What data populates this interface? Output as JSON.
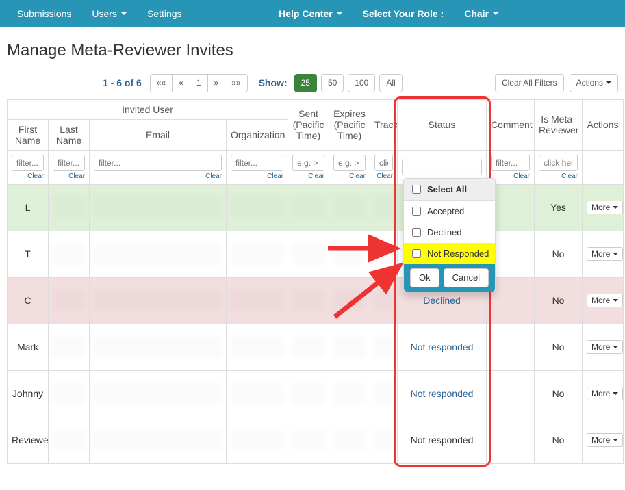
{
  "nav": {
    "submissions": "Submissions",
    "users": "Users",
    "settings": "Settings",
    "help": "Help Center",
    "role_label": "Select Your Role :",
    "role_value": "Chair"
  },
  "page_title": "Manage Meta-Reviewer Invites",
  "pager": {
    "info": "1 - 6 of 6",
    "first": "««",
    "prev": "«",
    "page": "1",
    "next": "»",
    "last": "»»"
  },
  "show": {
    "label": "Show:",
    "opt25": "25",
    "opt50": "50",
    "opt100": "100",
    "optAll": "All"
  },
  "clear_all": "Clear All Filters",
  "actions_label": "Actions",
  "headers": {
    "invited_user": "Invited User",
    "first_name": "First Name",
    "last_name": "Last Name",
    "email": "Email",
    "organization": "Organization",
    "sent": "Sent (Pacific Time)",
    "expires": "Expires (Pacific Time)",
    "track": "Track",
    "status": "Status",
    "comment": "Comment",
    "is_meta": "Is Meta-Reviewer",
    "actions": "Actions"
  },
  "filters": {
    "placeholder_filter": "filter...",
    "placeholder_eg": "e.g. >=",
    "placeholder_click": "click",
    "placeholder_clickhere": "click her",
    "clear": "Clear"
  },
  "dropdown": {
    "select_all": "Select All",
    "accepted": "Accepted",
    "declined": "Declined",
    "not_responded": "Not Responded",
    "ok": "Ok",
    "cancel": "Cancel"
  },
  "rows": [
    {
      "first": "L",
      "status": "",
      "meta": "Yes",
      "rowclass": "row-green"
    },
    {
      "first": "T",
      "status": "",
      "meta": "No",
      "rowclass": ""
    },
    {
      "first": "C",
      "status": "Declined",
      "meta": "No",
      "rowclass": "row-pink"
    },
    {
      "first": "Mark",
      "status": "Not responded",
      "meta": "No",
      "rowclass": ""
    },
    {
      "first": "Johnny",
      "status": "Not responded",
      "meta": "No",
      "rowclass": ""
    },
    {
      "first": "Reviewer",
      "status": "Not responded",
      "meta": "No",
      "rowclass": ""
    }
  ],
  "more_label": "More"
}
